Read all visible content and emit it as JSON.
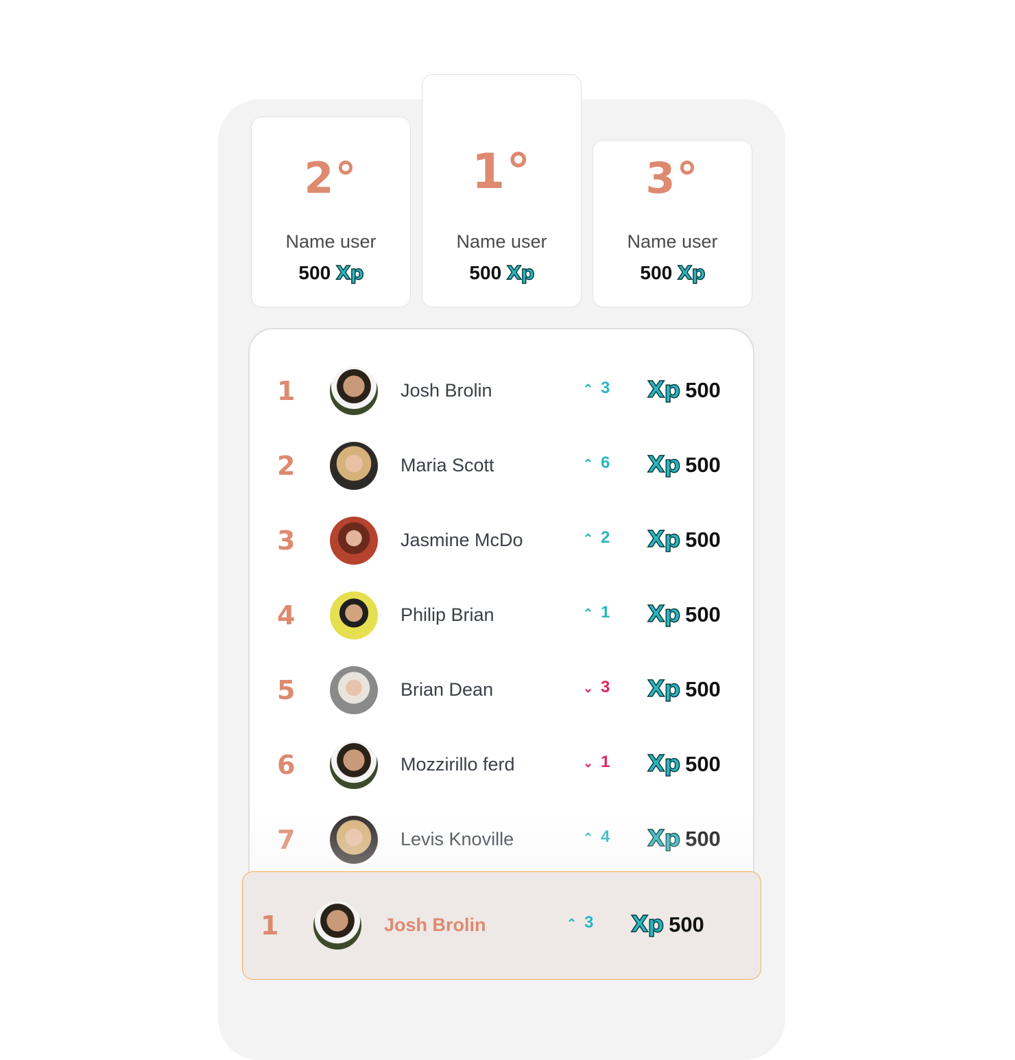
{
  "colors": {
    "accent": "#dd8a70",
    "teal": "#29b6bf",
    "down": "#e0245e",
    "panel": "#f3f3f3",
    "highlight_bg": "#eee8e6",
    "highlight_border": "#f0b060"
  },
  "podium": [
    {
      "rank": "2°",
      "name": "Name user",
      "xp_value": "500",
      "xp_label": "Xp"
    },
    {
      "rank": "1°",
      "name": "Name user",
      "xp_value": "500",
      "xp_label": "Xp"
    },
    {
      "rank": "3°",
      "name": "Name user",
      "xp_value": "500",
      "xp_label": "Xp"
    }
  ],
  "leaderboard": [
    {
      "position": "1",
      "name": "Josh Brolin",
      "trend": "up",
      "change": "3",
      "xp_label": "Xp",
      "xp": "500",
      "avatar": "man-dark-hair"
    },
    {
      "position": "2",
      "name": "Maria Scott",
      "trend": "up",
      "change": "6",
      "xp_label": "Xp",
      "xp": "500",
      "avatar": "woman-blonde"
    },
    {
      "position": "3",
      "name": "Jasmine McDo",
      "trend": "up",
      "change": "2",
      "xp_label": "Xp",
      "xp": "500",
      "avatar": "woman-red-bg"
    },
    {
      "position": "4",
      "name": "Philip Brian",
      "trend": "up",
      "change": "1",
      "xp_label": "Xp",
      "xp": "500",
      "avatar": "man-yellow-bg"
    },
    {
      "position": "5",
      "name": "Brian Dean",
      "trend": "down",
      "change": "3",
      "xp_label": "Xp",
      "xp": "500",
      "avatar": "woman-platinum"
    },
    {
      "position": "6",
      "name": "Mozzirillo ferd",
      "trend": "down",
      "change": "1",
      "xp_label": "Xp",
      "xp": "500",
      "avatar": "man-dark-hair"
    },
    {
      "position": "7",
      "name": "Levis Knoville",
      "trend": "up",
      "change": "4",
      "xp_label": "Xp",
      "xp": "500",
      "avatar": "woman-blonde"
    }
  ],
  "current_user": {
    "position": "1",
    "name": "Josh Brolin",
    "trend": "up",
    "change": "3",
    "xp_label": "Xp",
    "xp": "500",
    "avatar": "man-dark-hair"
  }
}
